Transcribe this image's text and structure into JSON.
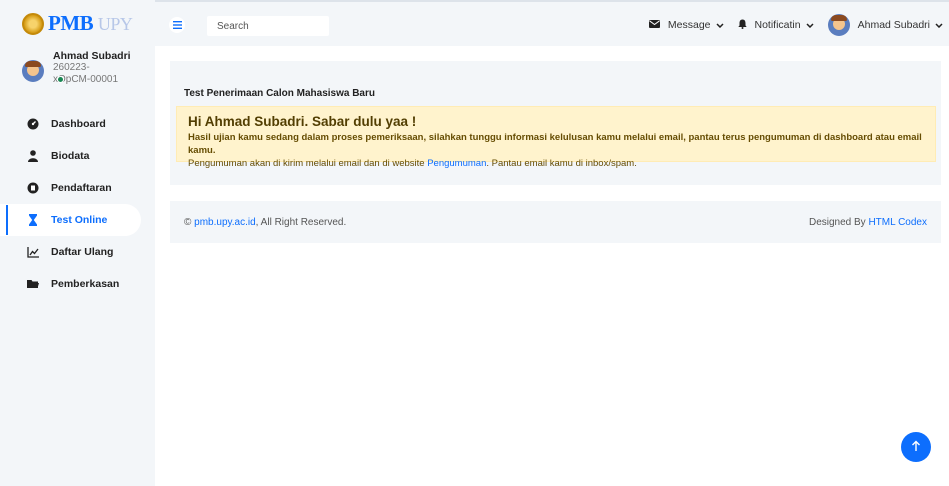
{
  "brand": {
    "logo_text": "PMB",
    "logo_faint": "UPY"
  },
  "user": {
    "name": "Ahmad Subadri",
    "id": "260223-xOpCM-00001"
  },
  "sidebar": {
    "items": [
      {
        "label": "Dashboard",
        "icon": "dashboard-icon"
      },
      {
        "label": "Biodata",
        "icon": "user-icon"
      },
      {
        "label": "Pendaftaran",
        "icon": "registration-icon"
      },
      {
        "label": "Test Online",
        "icon": "hourglass-icon",
        "active": true
      },
      {
        "label": "Daftar Ulang",
        "icon": "chart-icon"
      },
      {
        "label": "Pemberkasan",
        "icon": "folder-icon"
      }
    ]
  },
  "topbar": {
    "search_placeholder": "Search",
    "message_label": "Message",
    "notification_label": "Notificatin",
    "user_label": "Ahmad Subadri"
  },
  "main": {
    "card_title": "Test Penerimaan Calon Mahasiswa Baru",
    "alert_title": "Hi Ahmad Subadri. Sabar dulu yaa !",
    "alert_line1": "Hasil ujian kamu sedang dalam proses pemeriksaan, silahkan tunggu informasi kelulusan kamu melalui email, pantau terus pengumuman di dashboard atau email kamu.",
    "alert_line2_pre": "Pengumuman akan di kirim melalui email dan di website ",
    "alert_link": "Pengumuman",
    "alert_line2_post": ". Pantau email kamu di inbox/spam."
  },
  "footer": {
    "copyright_symbol": "©",
    "site_link": "pmb.upy.ac.id",
    "rights": ", All Right Reserved.",
    "designed_by": "Designed By",
    "designer_link": "HTML Codex"
  },
  "colors": {
    "accent": "#0d6efd",
    "alert_bg": "#fff3cd",
    "panel_bg": "#f3f6f9"
  }
}
